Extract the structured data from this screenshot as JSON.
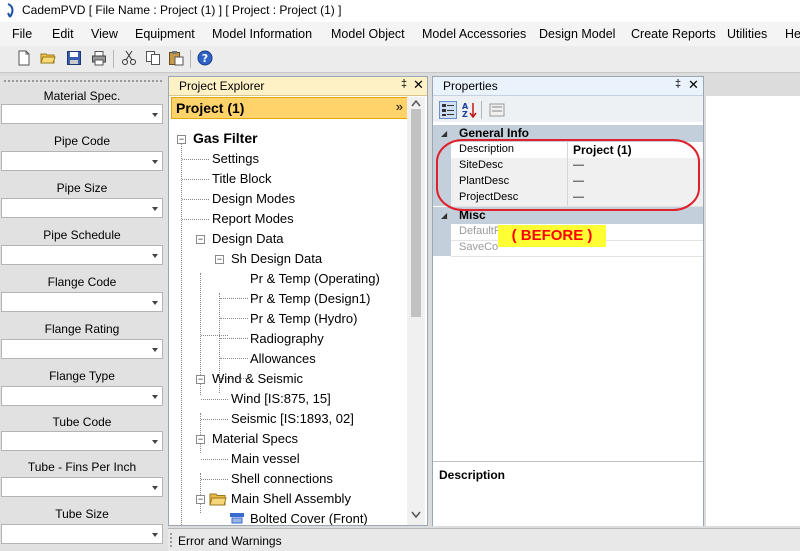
{
  "window": {
    "title": "CademPVD [ File Name : Project (1) ] [ Project : Project (1) ]"
  },
  "menu": [
    "File",
    "Edit",
    "View",
    "Equipment",
    "Model Information",
    "Model Object",
    "Model Accessories",
    "Design Model",
    "Create Reports",
    "Utilities",
    "He"
  ],
  "toolbar": [
    "new-file-icon",
    "open-folder-icon",
    "save-icon",
    "print-icon",
    "cut-icon",
    "copy-icon",
    "paste-icon",
    "help-icon"
  ],
  "left_panel": {
    "fields": [
      "Material Spec.",
      "Pipe Code",
      "Pipe Size",
      "Pipe Schedule",
      "Flange Code",
      "Flange Rating",
      "Flange Type",
      "Tube Code",
      "Tube - Fins Per Inch",
      "Tube Size"
    ]
  },
  "explorer": {
    "title": "Project Explorer",
    "pin": "‡",
    "close": "✕",
    "project": "Project (1)",
    "collapse": "»",
    "root": "Gas Filter",
    "tree": {
      "settings": "Settings",
      "title_block": "Title Block",
      "design_modes": "Design Modes",
      "report_modes": "Report Modes",
      "design_data": "Design Data",
      "sh_design_data": "Sh Design Data",
      "pr_temp_operating": "Pr & Temp (Operating)",
      "pr_temp_design1": "Pr & Temp (Design1)",
      "pr_temp_hydro": "Pr & Temp (Hydro)",
      "radiography": "Radiography",
      "allowances": "Allowances",
      "wind_seismic": "Wind & Seismic",
      "wind": "Wind [IS:875, 15]",
      "seismic": "Seismic [IS:1893, 02]",
      "material_specs": "Material Specs",
      "main_vessel": "Main vessel",
      "shell_connections": "Shell connections",
      "main_shell_assembly": "Main Shell Assembly",
      "bolted_cover": "Bolted Cover (Front)"
    }
  },
  "properties": {
    "title": "Properties",
    "pin": "‡",
    "close": "✕",
    "general_info": "General Info",
    "rows": [
      {
        "name": "Description",
        "value": "Project (1)"
      },
      {
        "name": "SiteDesc",
        "value": "—"
      },
      {
        "name": "PlantDesc",
        "value": "—"
      },
      {
        "name": "ProjectDesc",
        "value": "—"
      }
    ],
    "misc": "Misc",
    "misc_rows": [
      "DefaultF",
      "SaveCo"
    ],
    "before_label": "( BEFORE )",
    "description_label": "Description"
  },
  "bottom": {
    "label": "Error and Warnings"
  },
  "colors": {
    "highlight_ring": "#e0202a",
    "before_bg": "#ffff33",
    "before_text": "#ff0000",
    "project_header": "#ffd36a"
  }
}
